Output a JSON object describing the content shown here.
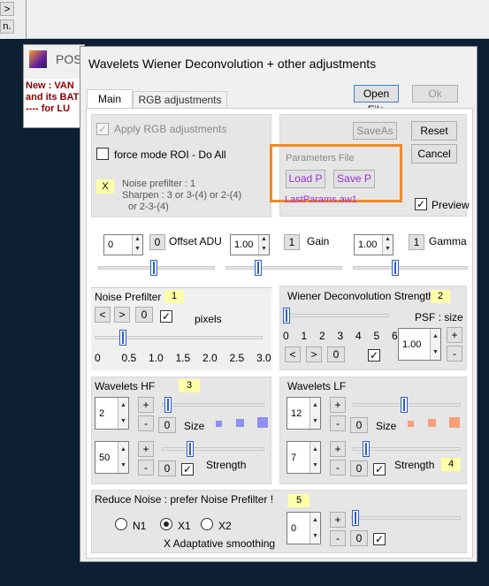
{
  "background_window": {
    "btn1_label": ">",
    "btn2_label": "n.",
    "pos_title": "POS",
    "note_line1": "New :  VAN",
    "note_line2": "and its BAT",
    "note_line3": "----    for LU"
  },
  "dialog": {
    "title": "Wavelets Wiener Deconvolution + other adjustments",
    "tabs": [
      "Main",
      "RGB adjustments"
    ],
    "open_file": "Open File",
    "ok": "Ok",
    "apply_rgb": "Apply RGB adjustments",
    "force_mode": "force mode  ROI - Do All",
    "x_note": "X",
    "noise_info_1": "Noise prefilter :  1",
    "noise_info_2": "Sharpen :  3  or  3-(4)  or  2-(4)",
    "noise_info_3": "or  2-3-(4)",
    "save_as": "SaveAs",
    "reset": "Reset",
    "cancel": "Cancel",
    "params_file": "Parameters File",
    "load_p": "Load P",
    "save_p": "Save P",
    "last_params": "LastParams.aw1",
    "preview": "Preview",
    "offset_value": "0",
    "offset_btn": "0",
    "offset_label": "Offset ADU",
    "gain_value": "1.00",
    "gain_btn": "1",
    "gain_label": "Gain",
    "gamma_value": "1.00",
    "gamma_btn": "1",
    "gamma_label": "Gamma",
    "noise_prefilter": {
      "title": "Noise Prefilter",
      "badge": "1",
      "btn_prev": "<",
      "btn_next": ">",
      "btn_zero": "0",
      "pixels": "pixels",
      "ticks": [
        "0",
        "0.5",
        "1.0",
        "1.5",
        "2.0",
        "2.5",
        "3.0"
      ]
    },
    "wiener": {
      "title": "Wiener Deconvolution Strength",
      "badge": "2",
      "psf_label": "PSF : size",
      "ticks": [
        "0",
        "1",
        "2",
        "3",
        "4",
        "5",
        "6"
      ],
      "btn_prev": "<",
      "btn_next": ">",
      "btn_zero": "0",
      "psf_value": "1.00",
      "plus": "+",
      "minus": "-"
    },
    "wavelets_hf": {
      "title": "Wavelets HF",
      "badge": "3",
      "size_value": "2",
      "size_zero": "0",
      "size_label": "Size",
      "strength_value": "50",
      "strength_zero": "0",
      "strength_label": "Strength",
      "plus": "+",
      "minus": "-"
    },
    "wavelets_lf": {
      "title": "Wavelets LF",
      "badge": "4",
      "size_value": "12",
      "size_zero": "0",
      "size_label": "Size",
      "strength_value": "7",
      "strength_zero": "0",
      "strength_label": "Strength",
      "plus": "+",
      "minus": "-"
    },
    "reduce_noise": {
      "title": "Reduce Noise :  prefer Noise Prefilter !",
      "badge": "5",
      "options": [
        "N1",
        "X1",
        "X2"
      ],
      "selected": "X1",
      "adaptive": "X Adaptative smoothing",
      "value": "0",
      "zero": "0",
      "plus": "+",
      "minus": "-"
    }
  },
  "colors": {
    "highlight_orange": "#f08a24",
    "accent_purple": "#9b30d9",
    "note_yellow": "#ffffaa",
    "hf_squares": "#8f8ff0",
    "lf_squares": "#f5a07a"
  }
}
